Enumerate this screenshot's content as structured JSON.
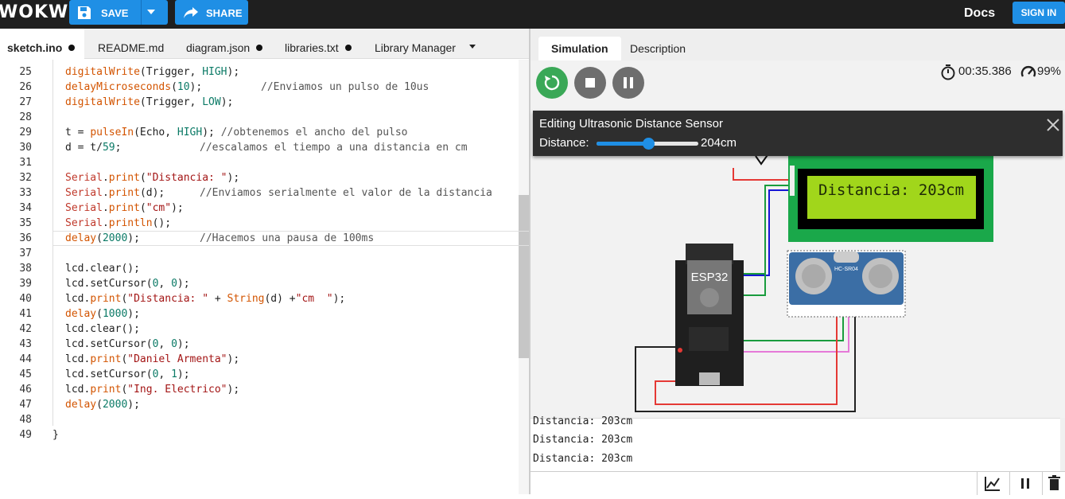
{
  "header": {
    "logo": "WOKWi",
    "save_label": "SAVE",
    "share_label": "SHARE",
    "docs_label": "Docs",
    "signin_label": "SIGN IN"
  },
  "editor_tabs": [
    {
      "label": "sketch.ino",
      "modified": true
    },
    {
      "label": "README.md",
      "modified": false
    },
    {
      "label": "diagram.json",
      "modified": true
    },
    {
      "label": "libraries.txt",
      "modified": true
    },
    {
      "label": "Library Manager",
      "modified": false
    }
  ],
  "code_lines": [
    {
      "n": "25"
    },
    {
      "n": "26"
    },
    {
      "n": "27"
    },
    {
      "n": "28"
    },
    {
      "n": "29"
    },
    {
      "n": "30"
    },
    {
      "n": "31"
    },
    {
      "n": "32"
    },
    {
      "n": "33"
    },
    {
      "n": "34"
    },
    {
      "n": "35"
    },
    {
      "n": "36"
    },
    {
      "n": "37"
    },
    {
      "n": "38"
    },
    {
      "n": "39"
    },
    {
      "n": "40"
    },
    {
      "n": "41"
    },
    {
      "n": "42"
    },
    {
      "n": "43"
    },
    {
      "n": "44"
    },
    {
      "n": "45"
    },
    {
      "n": "46"
    },
    {
      "n": "47"
    },
    {
      "n": "48"
    },
    {
      "n": "49"
    }
  ],
  "code": {
    "l25": [
      "digitalWrite",
      "(Trigger, ",
      "HIGH",
      ");"
    ],
    "l26": [
      "delayMicroseconds",
      "(",
      "10",
      ");",
      "//Enviamos un pulso de 10us"
    ],
    "l27": [
      "digitalWrite",
      "(Trigger, ",
      "LOW",
      ");"
    ],
    "l29": [
      "t = ",
      "pulseIn",
      "(Echo, ",
      "HIGH",
      "); ",
      "//obtenemos el ancho del pulso"
    ],
    "l30": [
      "d = t/",
      "59",
      ";",
      "//escalamos el tiempo a una distancia en cm"
    ],
    "l32": [
      "Serial",
      ".",
      "print",
      "(",
      "\"Distancia: \"",
      ");"
    ],
    "l33": [
      "Serial",
      ".",
      "print",
      "(d);",
      "//Enviamos serialmente el valor de la distancia"
    ],
    "l34": [
      "Serial",
      ".",
      "print",
      "(",
      "\"cm\"",
      ");"
    ],
    "l35": [
      "Serial",
      ".",
      "println",
      "();"
    ],
    "l36": [
      "delay",
      "(",
      "2000",
      ");",
      "//Hacemos una pausa de 100ms"
    ],
    "l38": [
      "lcd.clear();"
    ],
    "l39": [
      "lcd.setCursor(",
      "0",
      ", ",
      "0",
      ");"
    ],
    "l40": [
      "lcd.",
      "print",
      "(",
      "\"Distancia: \"",
      " + ",
      "String",
      "(d) +",
      "\"cm  \"",
      ");"
    ],
    "l41": [
      "delay",
      "(",
      "1000",
      ");"
    ],
    "l42": [
      "lcd.clear();"
    ],
    "l43": [
      "lcd.setCursor(",
      "0",
      ", ",
      "0",
      ");"
    ],
    "l44": [
      "lcd.",
      "print",
      "(",
      "\"Daniel Armenta\"",
      ");"
    ],
    "l45": [
      "lcd.setCursor(",
      "0",
      ", ",
      "1",
      ");"
    ],
    "l46": [
      "lcd.",
      "print",
      "(",
      "\"Ing. Electrico\"",
      ");"
    ],
    "l47": [
      "delay",
      "(",
      "2000",
      ");"
    ],
    "l49": [
      "}"
    ]
  },
  "right_tabs": {
    "simulation": "Simulation",
    "description": "Description"
  },
  "sim": {
    "timer": "00:35.386",
    "performance": "99%",
    "edit_title": "Editing Ultrasonic Distance Sensor",
    "distance_label": "Distance:",
    "distance_value": "204cm",
    "distance_fraction": 0.51,
    "lcd_text": "Distancia: 203cm",
    "esp_label": "ESP32",
    "sensor_label": "HC-SR04"
  },
  "serial": [
    "Distancia: 203cm",
    "Distancia: 203cm",
    "Distancia: 203cm"
  ],
  "colors": {
    "accent": "#1f8fe5",
    "run": "#3aa857",
    "lcd_bg": "#a1d61b",
    "pcb": "#1aa84a",
    "sensor": "#3b6ea5"
  }
}
